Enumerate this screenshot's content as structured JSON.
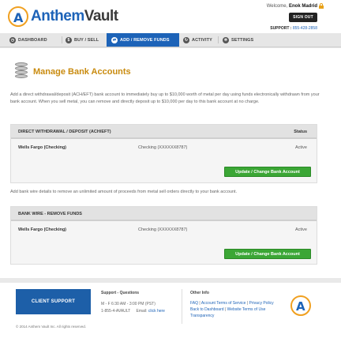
{
  "header": {
    "logo_a": "A",
    "logo_anthem": "Anthem",
    "logo_vault": "Vault",
    "welcome_prefix": "Welcome,",
    "user_name": "Enok Madrid",
    "signout_label": "SIGN OUT",
    "support_label": "SUPPORT :",
    "support_phone": "855-428-2858"
  },
  "nav": {
    "items": [
      {
        "label": "DASHBOARD",
        "icon": "dashboard-icon"
      },
      {
        "label": "BUY / SELL",
        "icon": "buy-sell-icon"
      },
      {
        "label": "ADD / REMOVE FUNDS",
        "icon": "add-remove-funds-icon",
        "active": true
      },
      {
        "label": "ACTIVITY",
        "icon": "activity-icon"
      },
      {
        "label": "SETTINGS",
        "icon": "gear-icon"
      }
    ]
  },
  "main": {
    "title": "Manage Bank Accounts",
    "intro": "Add a direct withdrawal/deposit (ACH/EFT) bank account to immediately buy up to $10,000 worth of metal per day using funds electronically withdrawn from your bank account. When you sell metal, you can remove and directly deposit up to $10,000 per day to this bank account at no charge.",
    "ach_panel": {
      "heading": "DIRECT WITHDRAWAL / DEPOSIT (ACH/EFT)",
      "status_heading": "Status",
      "bank": "Wells Fargo (Checking)",
      "account": "Checking (XXXXXX8787)",
      "status": "Active",
      "button_label": "Update / Change Bank Account"
    },
    "wire_text": "Add bank wire details to remove an unlimited amount of proceeds from metal sell orders directly to your bank account.",
    "wire_panel": {
      "heading": "BANK WIRE - REMOVE FUNDS",
      "bank": "Wells Fargo (Checking)",
      "account": "Checking (XXXXXX8787)",
      "status": "Active",
      "button_label": "Update / Change Bank Account"
    }
  },
  "footer": {
    "client_support_label": "CLIENT SUPPORT",
    "support_title": "Support - Questions",
    "hours": "M - F 6:30 AM - 3:00 PM (PST)",
    "phone": "1-855-4-AVAULT",
    "email_label": "Email:",
    "email_link": "click here",
    "other_title": "Other Info",
    "links": [
      "FAQ",
      "Account Terms of Service",
      "Privacy Policy",
      "Back to Dashboard",
      "Website Terms of Use",
      "Transparency"
    ],
    "separator": "|",
    "copyright": "© 2014 Anthem Vault Inc. All rights reserved."
  },
  "colors": {
    "brand_blue": "#1d63b8",
    "brand_gold": "#f0a020",
    "button_green": "#3ba635"
  }
}
